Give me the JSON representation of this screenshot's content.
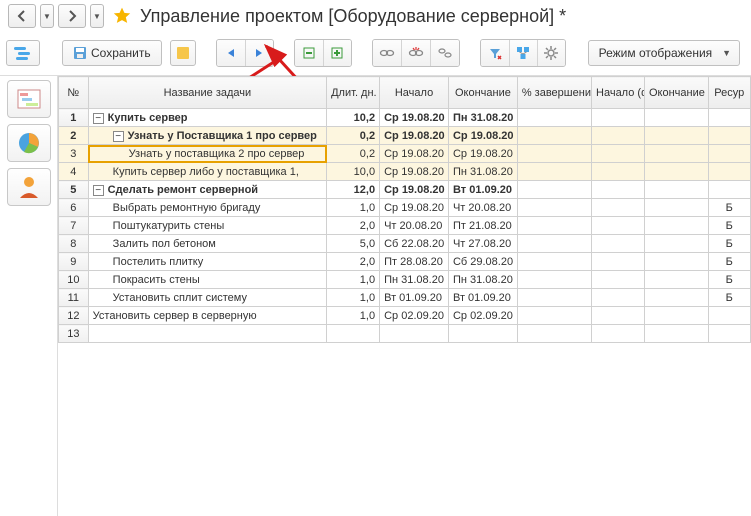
{
  "header": {
    "title": "Управление проектом [Оборудование серверной] *"
  },
  "toolbar": {
    "save": "Сохранить",
    "view_mode": "Режим отображения"
  },
  "columns": {
    "num": "№",
    "name": "Название задачи",
    "duration": "Длит. дн.",
    "start": "Начало",
    "end": "Окончание",
    "pct": "% завершения",
    "start_fact": "Начало (факт.)",
    "end_fact": "Окончание (факт.)",
    "resource": "Ресур"
  },
  "rows": [
    {
      "n": "1",
      "name": "Купить сервер",
      "dur": "10,2",
      "start": "Ср 19.08.20",
      "end": "Пн 31.08.20",
      "pct": "",
      "sf": "",
      "ef": "",
      "res": "",
      "bold": true,
      "indent": 0,
      "toggle": "-"
    },
    {
      "n": "2",
      "name": "Узнать у Поставщика 1 про сервер",
      "dur": "0,2",
      "start": "Ср 19.08.20",
      "end": "Ср 19.08.20",
      "pct": "",
      "sf": "",
      "ef": "",
      "res": "",
      "bold": true,
      "indent": 1,
      "toggle": "-",
      "hl": true
    },
    {
      "n": "3",
      "name": "Узнать у поставщика 2 про сервер",
      "dur": "0,2",
      "start": "Ср 19.08.20",
      "end": "Ср 19.08.20",
      "pct": "",
      "sf": "",
      "ef": "",
      "res": "",
      "bold": false,
      "indent": 2,
      "hl": true,
      "selected": true
    },
    {
      "n": "4",
      "name": "Купить сервер либо у поставщика 1,",
      "dur": "10,0",
      "start": "Ср 19.08.20",
      "end": "Пн 31.08.20",
      "pct": "",
      "sf": "",
      "ef": "",
      "res": "",
      "bold": false,
      "indent": 1,
      "hl": true
    },
    {
      "n": "5",
      "name": "Сделать ремонт серверной",
      "dur": "12,0",
      "start": "Ср 19.08.20",
      "end": "Вт 01.09.20",
      "pct": "",
      "sf": "",
      "ef": "",
      "res": "",
      "bold": true,
      "indent": 0,
      "toggle": "-"
    },
    {
      "n": "6",
      "name": "Выбрать ремонтную бригаду",
      "dur": "1,0",
      "start": "Ср 19.08.20",
      "end": "Чт 20.08.20",
      "pct": "",
      "sf": "",
      "ef": "",
      "res": "Б",
      "bold": false,
      "indent": 1
    },
    {
      "n": "7",
      "name": "Поштукатурить стены",
      "dur": "2,0",
      "start": "Чт 20.08.20",
      "end": "Пт 21.08.20",
      "pct": "",
      "sf": "",
      "ef": "",
      "res": "Б",
      "bold": false,
      "indent": 1
    },
    {
      "n": "8",
      "name": "Залить пол бетоном",
      "dur": "5,0",
      "start": "Сб 22.08.20",
      "end": "Чт 27.08.20",
      "pct": "",
      "sf": "",
      "ef": "",
      "res": "Б",
      "bold": false,
      "indent": 1
    },
    {
      "n": "9",
      "name": "Постелить плитку",
      "dur": "2,0",
      "start": "Пт 28.08.20",
      "end": "Сб 29.08.20",
      "pct": "",
      "sf": "",
      "ef": "",
      "res": "Б",
      "bold": false,
      "indent": 1
    },
    {
      "n": "10",
      "name": "Покрасить стены",
      "dur": "1,0",
      "start": "Пн 31.08.20",
      "end": "Пн 31.08.20",
      "pct": "",
      "sf": "",
      "ef": "",
      "res": "Б",
      "bold": false,
      "indent": 1
    },
    {
      "n": "11",
      "name": "Установить сплит систему",
      "dur": "1,0",
      "start": "Вт 01.09.20",
      "end": "Вт 01.09.20",
      "pct": "",
      "sf": "",
      "ef": "",
      "res": "Б",
      "bold": false,
      "indent": 1
    },
    {
      "n": "12",
      "name": "Установить сервер в серверную",
      "dur": "1,0",
      "start": "Ср 02.09.20",
      "end": "Ср 02.09.20",
      "pct": "",
      "sf": "",
      "ef": "",
      "res": "",
      "bold": false,
      "indent": 0
    },
    {
      "n": "13",
      "name": "",
      "dur": "",
      "start": "",
      "end": "",
      "pct": "",
      "sf": "",
      "ef": "",
      "res": "",
      "bold": false,
      "indent": 0
    }
  ]
}
